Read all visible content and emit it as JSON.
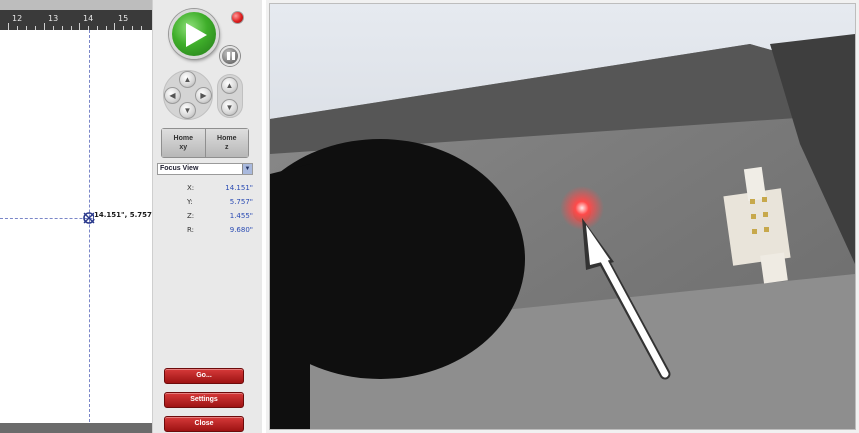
{
  "ruler": {
    "labels": [
      "12",
      "13",
      "14",
      "15"
    ]
  },
  "canvas": {
    "cursor_coordinates": "14.151\", 5.757\""
  },
  "controls": {
    "home_xy_line1": "Home",
    "home_xy_line2": "xy",
    "home_z_line1": "Home",
    "home_z_line2": "z",
    "view_select_value": "Focus View",
    "readouts": [
      {
        "axis": "X:",
        "value": "14.151\""
      },
      {
        "axis": "Y:",
        "value": "5.757\""
      },
      {
        "axis": "Z:",
        "value": "1.455\""
      },
      {
        "axis": "R:",
        "value": "9.680\""
      }
    ],
    "go_label": "Go...",
    "settings_label": "Settings",
    "close_label": "Close"
  },
  "colors": {
    "play_green": "#3fae2a",
    "stop_red": "#e02020",
    "action_red": "#b21e1e",
    "readout_blue": "#2a4bb3",
    "guide_blue": "#7a86c8"
  },
  "icons": {
    "play": "play-icon",
    "pause": "pause-icon",
    "stop": "stop-indicator-icon",
    "jog": [
      "jog-up-icon",
      "jog-down-icon",
      "jog-left-icon",
      "jog-right-icon",
      "jog-z-up-icon",
      "jog-z-down-icon"
    ],
    "crosshair": "crosshair-icon"
  }
}
